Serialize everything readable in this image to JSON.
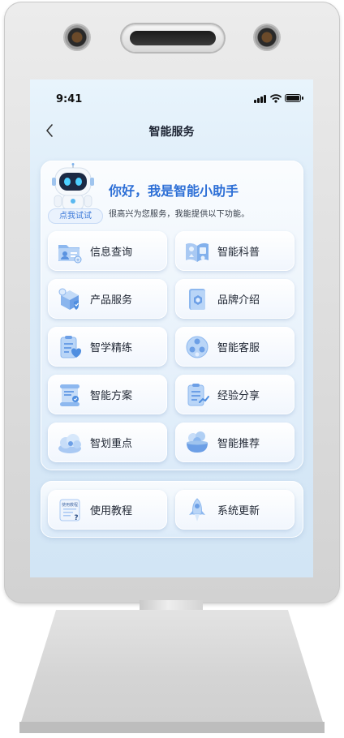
{
  "status": {
    "time": "9:41"
  },
  "nav": {
    "title": "智能服务"
  },
  "assistant": {
    "greeting": "你好，我是智能小助手",
    "description": "很高兴为您服务，我能提供以下功能。",
    "try_label": "点我试试"
  },
  "services": [
    {
      "label": "信息查询",
      "icon": "info-query-icon"
    },
    {
      "label": "智能科普",
      "icon": "science-book-icon"
    },
    {
      "label": "产品服务",
      "icon": "product-box-icon"
    },
    {
      "label": "品牌介绍",
      "icon": "brand-book-icon"
    },
    {
      "label": "智学精练",
      "icon": "study-clipboard-icon"
    },
    {
      "label": "智能客服",
      "icon": "customer-service-icon"
    },
    {
      "label": "智能方案",
      "icon": "scroll-plan-icon"
    },
    {
      "label": "经验分享",
      "icon": "experience-clipboard-icon"
    },
    {
      "label": "智划重点",
      "icon": "highlight-cloud-icon"
    },
    {
      "label": "智能推荐",
      "icon": "recommend-bowl-icon"
    }
  ],
  "utilities": [
    {
      "label": "使用教程",
      "icon": "tutorial-doc-icon",
      "icon_text": "使用教程"
    },
    {
      "label": "系统更新",
      "icon": "rocket-icon"
    }
  ],
  "colors": {
    "accent": "#2d6fd6",
    "icon_blue": "#6fa3ea",
    "icon_light": "#b9d5f7",
    "screen_bg": "#dcebf8"
  }
}
